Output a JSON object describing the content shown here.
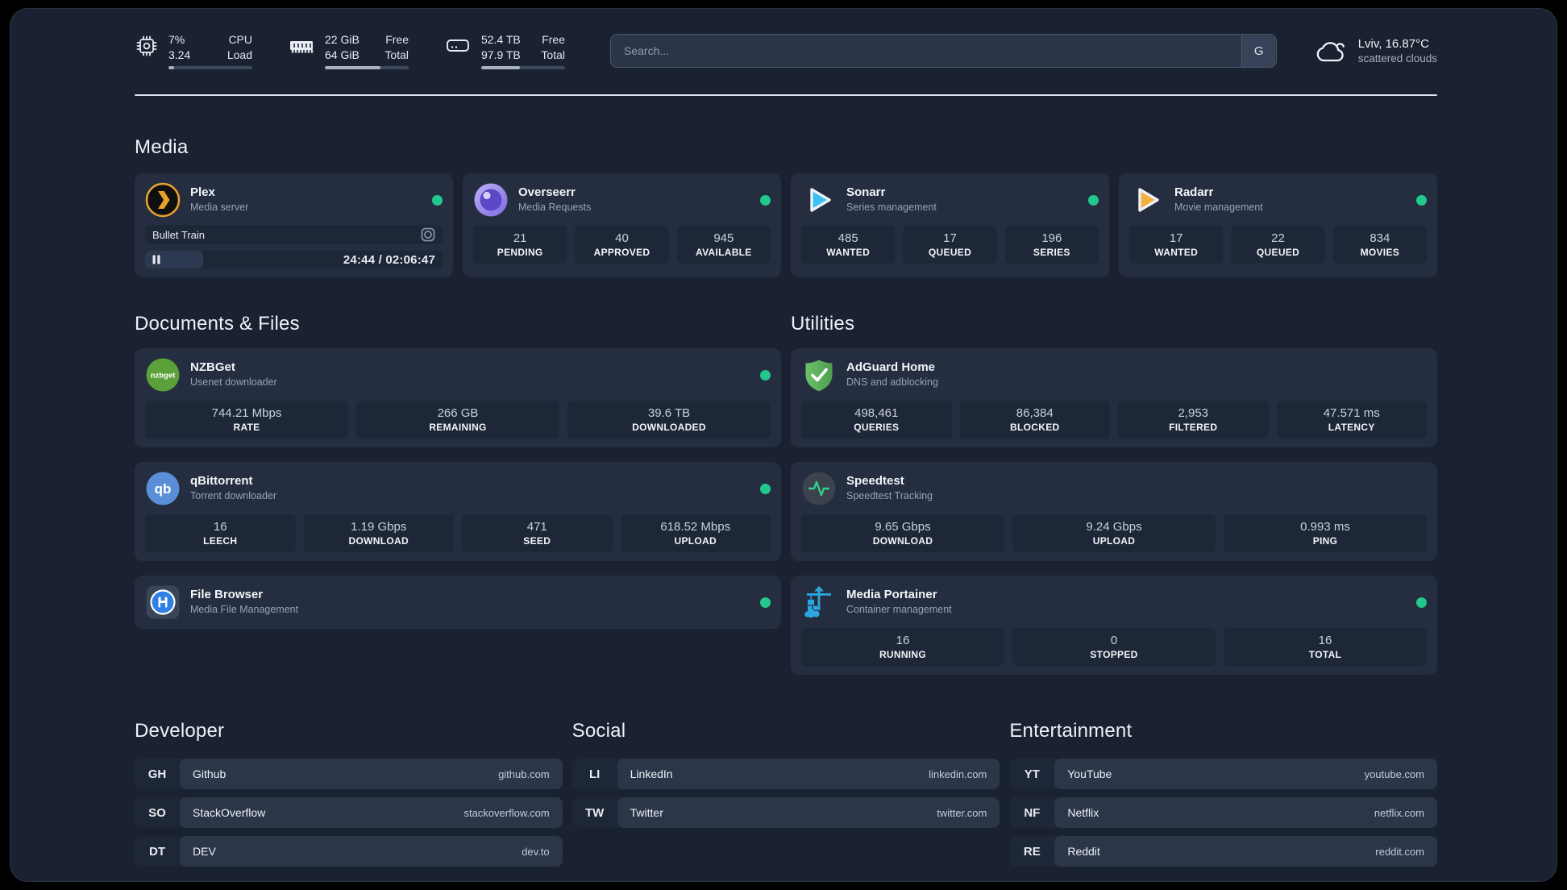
{
  "header": {
    "stats": [
      {
        "icon": "cpu-icon",
        "value_top": "7%",
        "value_bottom": "3.24",
        "label_top": "CPU",
        "label_bottom": "Load",
        "progress_percent": 7
      },
      {
        "icon": "ram-icon",
        "value_top": "22 GiB",
        "value_bottom": "64 GiB",
        "label_top": "Free",
        "label_bottom": "Total",
        "progress_percent": 66
      },
      {
        "icon": "disk-icon",
        "value_top": "52.4 TB",
        "value_bottom": "97.9 TB",
        "label_top": "Free",
        "label_bottom": "Total",
        "progress_percent": 46
      }
    ],
    "search": {
      "placeholder": "Search...",
      "engine_button": "G"
    },
    "weather": {
      "location_temp": "Lviv, 16.87°C",
      "condition": "scattered clouds"
    }
  },
  "media": {
    "title": "Media",
    "plex": {
      "name": "Plex",
      "subtitle": "Media server",
      "status": "online",
      "now_playing": "Bullet Train",
      "time": "24:44 / 02:06:47",
      "state": "paused",
      "progress_percent": 19.5
    },
    "cards": [
      {
        "name": "Overseerr",
        "subtitle": "Media Requests",
        "status": "online",
        "stats": [
          {
            "value": "21",
            "label": "PENDING"
          },
          {
            "value": "40",
            "label": "APPROVED"
          },
          {
            "value": "945",
            "label": "AVAILABLE"
          }
        ]
      },
      {
        "name": "Sonarr",
        "subtitle": "Series management",
        "status": "online",
        "stats": [
          {
            "value": "485",
            "label": "WANTED"
          },
          {
            "value": "17",
            "label": "QUEUED"
          },
          {
            "value": "196",
            "label": "SERIES"
          }
        ]
      },
      {
        "name": "Radarr",
        "subtitle": "Movie management",
        "status": "online",
        "stats": [
          {
            "value": "17",
            "label": "WANTED"
          },
          {
            "value": "22",
            "label": "QUEUED"
          },
          {
            "value": "834",
            "label": "MOVIES"
          }
        ]
      }
    ]
  },
  "documents": {
    "title": "Documents & Files",
    "cards": [
      {
        "name": "NZBGet",
        "subtitle": "Usenet downloader",
        "status": "online",
        "stats": [
          {
            "value": "744.21 Mbps",
            "label": "RATE"
          },
          {
            "value": "266 GB",
            "label": "REMAINING"
          },
          {
            "value": "39.6 TB",
            "label": "DOWNLOADED"
          }
        ]
      },
      {
        "name": "qBittorrent",
        "subtitle": "Torrent downloader",
        "status": "online",
        "stats": [
          {
            "value": "16",
            "label": "LEECH"
          },
          {
            "value": "1.19 Gbps",
            "label": "DOWNLOAD"
          },
          {
            "value": "471",
            "label": "SEED"
          },
          {
            "value": "618.52 Mbps",
            "label": "UPLOAD"
          }
        ]
      },
      {
        "name": "File Browser",
        "subtitle": "Media File Management",
        "status": "online",
        "stats": []
      }
    ]
  },
  "utilities": {
    "title": "Utilities",
    "cards": [
      {
        "name": "AdGuard Home",
        "subtitle": "DNS and adblocking",
        "status": "none",
        "stats": [
          {
            "value": "498,461",
            "label": "QUERIES"
          },
          {
            "value": "86,384",
            "label": "BLOCKED"
          },
          {
            "value": "2,953",
            "label": "FILTERED"
          },
          {
            "value": "47.571 ms",
            "label": "LATENCY"
          }
        ]
      },
      {
        "name": "Speedtest",
        "subtitle": "Speedtest Tracking",
        "status": "none",
        "stats": [
          {
            "value": "9.65 Gbps",
            "label": "DOWNLOAD"
          },
          {
            "value": "9.24 Gbps",
            "label": "UPLOAD"
          },
          {
            "value": "0.993 ms",
            "label": "PING"
          }
        ]
      },
      {
        "name": "Media Portainer",
        "subtitle": "Container management",
        "status": "online",
        "stats": [
          {
            "value": "16",
            "label": "RUNNING"
          },
          {
            "value": "0",
            "label": "STOPPED"
          },
          {
            "value": "16",
            "label": "TOTAL"
          }
        ]
      }
    ]
  },
  "bookmarks": [
    {
      "title": "Developer",
      "links": [
        {
          "abbr": "GH",
          "name": "Github",
          "url": "github.com"
        },
        {
          "abbr": "SO",
          "name": "StackOverflow",
          "url": "stackoverflow.com"
        },
        {
          "abbr": "DT",
          "name": "DEV",
          "url": "dev.to"
        }
      ]
    },
    {
      "title": "Social",
      "links": [
        {
          "abbr": "LI",
          "name": "LinkedIn",
          "url": "linkedin.com"
        },
        {
          "abbr": "TW",
          "name": "Twitter",
          "url": "twitter.com"
        }
      ]
    },
    {
      "title": "Entertainment",
      "links": [
        {
          "abbr": "YT",
          "name": "YouTube",
          "url": "youtube.com"
        },
        {
          "abbr": "NF",
          "name": "Netflix",
          "url": "netflix.com"
        },
        {
          "abbr": "RE",
          "name": "Reddit",
          "url": "reddit.com"
        }
      ]
    }
  ],
  "icons": {
    "nzbget_label": "nzbget",
    "qbittorrent_label": "qb"
  },
  "colors": {
    "status_green": "#23c98c",
    "plex_orange": "#e8a22c",
    "page_bg": "#1a2232",
    "card_bg": "#242e40"
  }
}
